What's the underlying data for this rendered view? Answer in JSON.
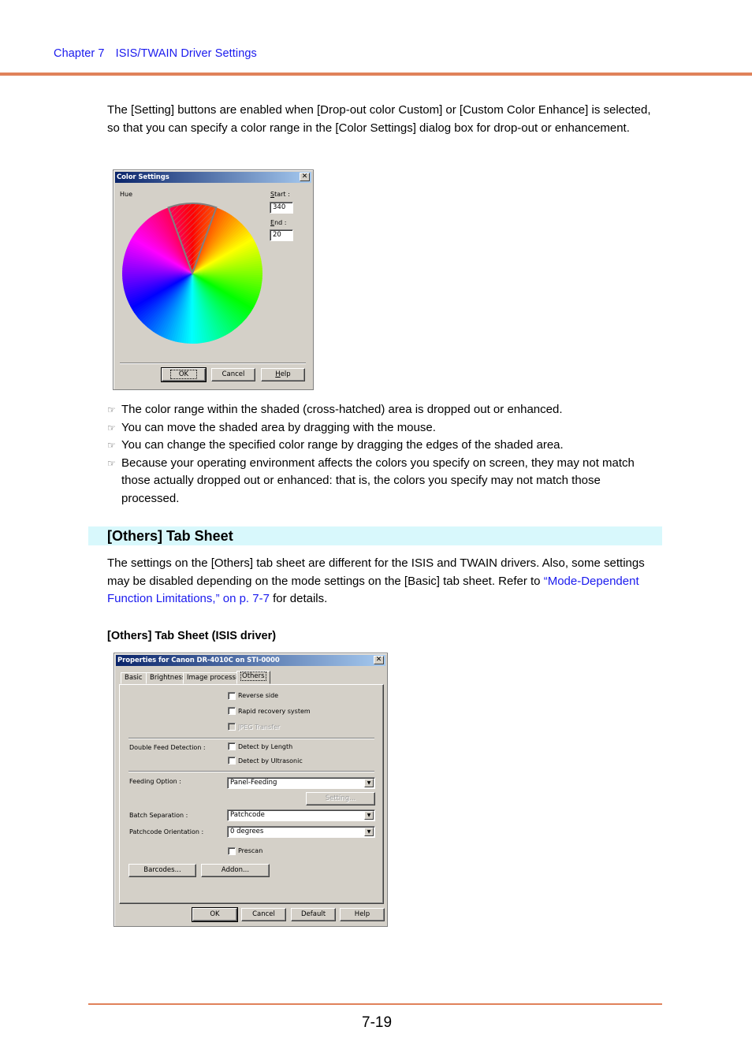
{
  "header": {
    "chapter": "Chapter 7",
    "title": "ISIS/TWAIN Driver Settings"
  },
  "intro_paragraph": "The [Setting] buttons are enabled when [Drop-out color Custom] or [Custom Color Enhance] is selected, so that you can specify a color range in the [Color Settings] dialog box for drop-out or enhancement.",
  "color_dialog": {
    "title": "Color Settings",
    "close_glyph": "✕",
    "hue_label": "Hue",
    "start_label_prefix": "S",
    "start_label_rest": "tart :",
    "start_value": "340",
    "end_label_prefix": "E",
    "end_label_rest": "nd :",
    "end_value": "20",
    "selected_hue_range": {
      "start_deg": 340,
      "end_deg": 20
    },
    "buttons": {
      "ok": "OK",
      "cancel": "Cancel",
      "help_prefix": "H",
      "help_rest": "elp"
    }
  },
  "bullets": {
    "icon": "pointing-hand-icon",
    "items": [
      "The color range within the shaded (cross-hatched) area is dropped out or enhanced.",
      "You can move the shaded area by dragging with the mouse.",
      "You can change the specified color range by dragging the edges of the shaded area.",
      "Because your operating environment affects the colors you specify on screen, they may not match those actually dropped out or enhanced: that is, the colors you specify may not match those processed."
    ]
  },
  "section": {
    "title": "[Others] Tab Sheet",
    "paragraph_before_link": "The settings on the [Others] tab sheet are different for the ISIS and TWAIN drivers. Also, some settings may be disabled depending on the mode settings on the [Basic] tab sheet. Refer to ",
    "link_text": "“Mode-Dependent Function Limitations,” on p. 7-7",
    "paragraph_after_link": " for details.",
    "subheading": "[Others] Tab Sheet (ISIS driver)"
  },
  "props_dialog": {
    "title": "Properties for Canon DR-4010C on STI-0000",
    "close_glyph": "✕",
    "tabs": [
      {
        "label": "Basic",
        "active": false
      },
      {
        "label": "Brightness",
        "active": false
      },
      {
        "label": "Image processing",
        "active": false
      },
      {
        "label": "Others",
        "active": true
      }
    ],
    "checkboxes": {
      "reverse_side": {
        "label": "Reverse side",
        "checked": false,
        "enabled": true
      },
      "rapid_recovery": {
        "label": "Rapid recovery system",
        "checked": false,
        "enabled": true
      },
      "jpeg_transfer": {
        "label": "JPEG Transfer",
        "checked": false,
        "enabled": false
      },
      "detect_length": {
        "label": "Detect by Length",
        "checked": false,
        "enabled": true
      },
      "detect_ultrasonic": {
        "label": "Detect by Ultrasonic",
        "checked": false,
        "enabled": true
      },
      "prescan": {
        "label": "Prescan",
        "checked": false,
        "enabled": true
      }
    },
    "labels": {
      "double_feed": "Double Feed Detection :",
      "feeding_option": "Feeding Option :",
      "batch_separation": "Batch Separation :",
      "patchcode_orientation": "Patchcode Orientation :"
    },
    "selects": {
      "feeding_option": "Panel-Feeding",
      "batch_separation": "Patchcode",
      "patchcode_orientation": "0 degrees"
    },
    "dropdown_arrow": "▼",
    "setting_button": "Setting...",
    "barcodes_button": "Barcodes...",
    "addon_button": "Addon...",
    "footer_buttons": {
      "ok": "OK",
      "cancel": "Cancel",
      "default": "Default",
      "help": "Help"
    }
  },
  "footer": {
    "page_number": "7-19"
  }
}
